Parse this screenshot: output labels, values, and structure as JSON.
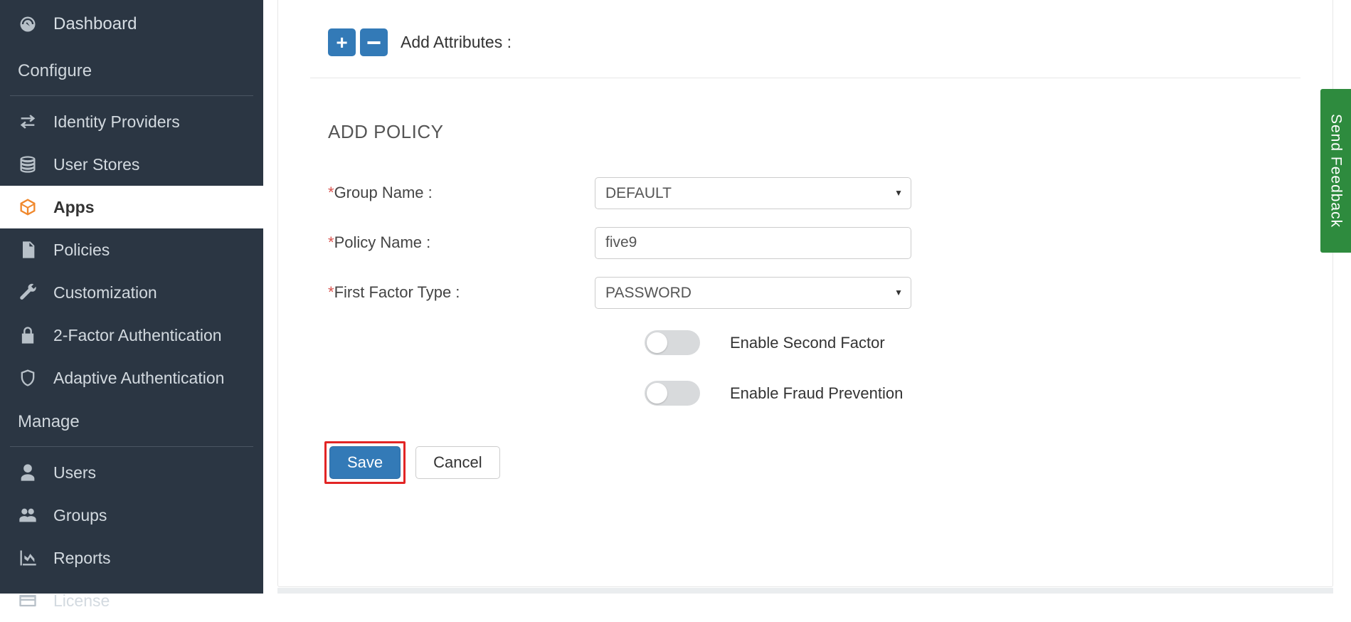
{
  "sidebar": {
    "dashboard_label": "Dashboard",
    "configure_label": "Configure",
    "manage_label": "Manage",
    "items_configure": [
      {
        "label": "Identity Providers",
        "icon": "exchange-icon"
      },
      {
        "label": "User Stores",
        "icon": "database-icon"
      },
      {
        "label": "Apps",
        "icon": "cube-icon",
        "active": true
      },
      {
        "label": "Policies",
        "icon": "document-icon"
      },
      {
        "label": "Customization",
        "icon": "wrench-icon"
      },
      {
        "label": "2-Factor Authentication",
        "icon": "lock-icon"
      },
      {
        "label": "Adaptive Authentication",
        "icon": "shield-icon"
      }
    ],
    "items_manage": [
      {
        "label": "Users",
        "icon": "user-icon"
      },
      {
        "label": "Groups",
        "icon": "users-icon"
      },
      {
        "label": "Reports",
        "icon": "chart-icon"
      },
      {
        "label": "License",
        "icon": "card-icon"
      }
    ]
  },
  "attributes": {
    "add_label": "Add Attributes :"
  },
  "policy": {
    "heading": "ADD POLICY",
    "group_name_label": "Group Name :",
    "group_name_value": "DEFAULT",
    "policy_name_label": "Policy Name :",
    "policy_name_value": "five9",
    "first_factor_label": "First Factor Type :",
    "first_factor_value": "PASSWORD",
    "enable_second_factor_label": "Enable Second Factor",
    "enable_fraud_prevention_label": "Enable Fraud Prevention"
  },
  "buttons": {
    "save": "Save",
    "cancel": "Cancel"
  },
  "feedback": {
    "label": "Send Feedback"
  }
}
